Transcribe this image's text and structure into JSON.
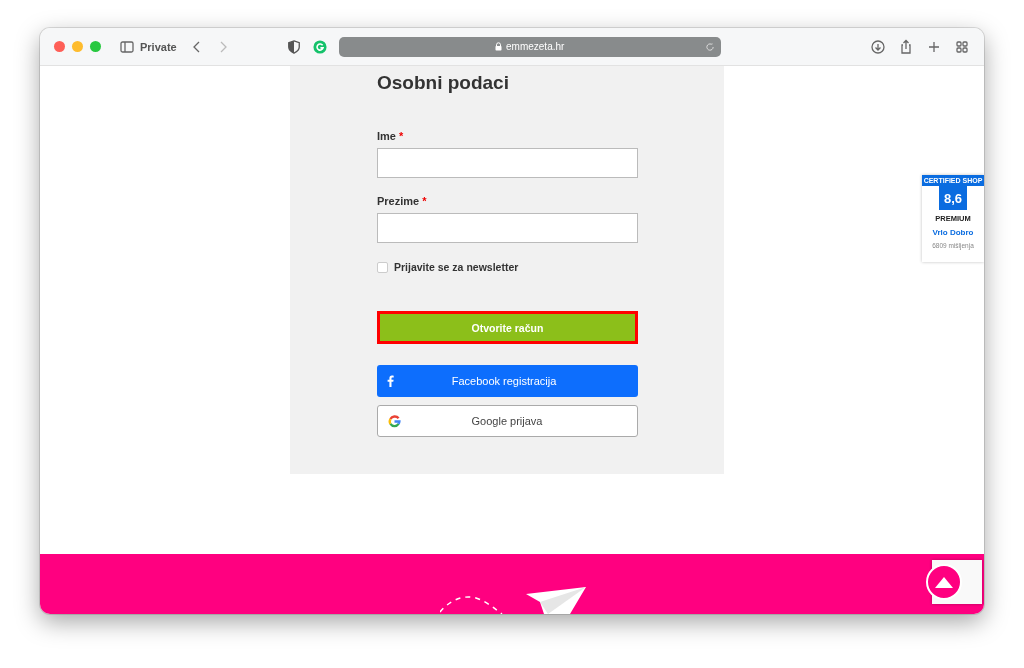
{
  "browser": {
    "private_label": "Private",
    "url": "emmezeta.hr"
  },
  "form": {
    "title": "Osobni podaci",
    "fields": [
      {
        "label": "Ime",
        "required_mark": "*"
      },
      {
        "label": "Prezime",
        "required_mark": "*"
      }
    ],
    "newsletter": {
      "label": "Prijavite se za newsletter",
      "checked": false
    },
    "submit": {
      "label": "Otvorite račun",
      "highlighted": true
    },
    "social": [
      {
        "kind": "facebook",
        "label": "Facebook registracija"
      },
      {
        "kind": "google",
        "label": "Google prijava"
      }
    ]
  },
  "badge": {
    "header": "CERTIFIED SHOP",
    "score": "8,6",
    "tier": "PREMIUM",
    "rating": "Vrlo Dobro",
    "reviews": "6809 mišljenja"
  }
}
